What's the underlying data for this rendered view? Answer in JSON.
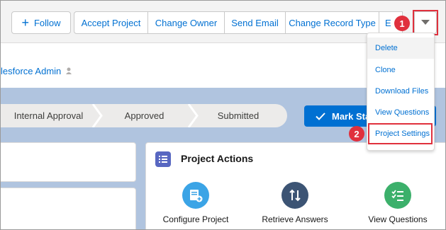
{
  "toolbar": {
    "follow_label": "Follow",
    "buttons": [
      "Accept Project",
      "Change Owner",
      "Send Email",
      "Change Record Type",
      "E"
    ]
  },
  "owner": {
    "name": "lesforce Admin"
  },
  "path": {
    "steps": [
      "Internal Approval",
      "Approved",
      "Submitted"
    ],
    "mark_label": "Mark Stat"
  },
  "project_actions": {
    "title": "Project Actions",
    "actions": [
      {
        "label": "Configure Project",
        "icon": "configure-icon",
        "color": "#3ba4e6"
      },
      {
        "label": "Retrieve Answers",
        "icon": "sort-icon",
        "color": "#3c5474"
      },
      {
        "label": "View Questions",
        "icon": "checklist-icon",
        "color": "#3cb06b"
      }
    ]
  },
  "menu": {
    "items": [
      "Delete",
      "Clone",
      "Download Files",
      "View Questions",
      "Project Settings"
    ]
  },
  "callouts": {
    "one": "1",
    "two": "2"
  },
  "colors": {
    "accent": "#0070d2",
    "callout": "#e0303d"
  }
}
